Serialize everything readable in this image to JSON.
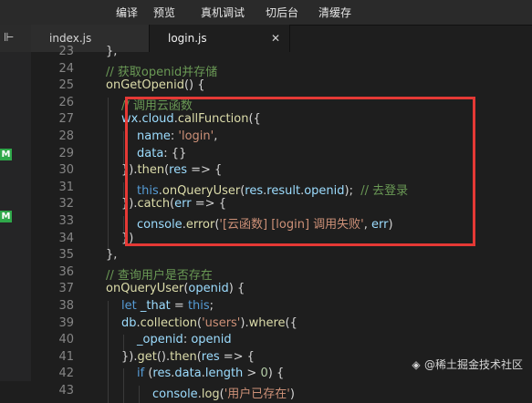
{
  "toolbar": {
    "items": [
      "编译",
      "预览",
      "真机调试",
      "切后台",
      "清缓存"
    ]
  },
  "tabs": [
    {
      "label": "index.js",
      "active": false
    },
    {
      "label": "login.js",
      "active": true
    }
  ],
  "sidebar": {
    "collapse_icon": "sidebar-collapse-icon",
    "badges": [
      "M",
      "M"
    ]
  },
  "line_numbers": [
    "23",
    "24",
    "25",
    "26",
    "27",
    "28",
    "29",
    "30",
    "31",
    "32",
    "33",
    "34",
    "35",
    "36",
    "37",
    "38",
    "39",
    "40",
    "41",
    "42",
    "43"
  ],
  "code": [
    {
      "indent": 1,
      "tokens": [
        {
          "t": "},",
          "c": ""
        }
      ]
    },
    {
      "indent": 1,
      "tokens": [
        {
          "t": "// 获取openid并存储",
          "c": "c"
        }
      ]
    },
    {
      "indent": 1,
      "tokens": [
        {
          "t": "onGetOpenid",
          "c": "f"
        },
        {
          "t": "() {",
          "c": ""
        }
      ]
    },
    {
      "indent": 2,
      "tokens": [
        {
          "t": "// 调用云函数",
          "c": "c"
        }
      ]
    },
    {
      "indent": 2,
      "tokens": [
        {
          "t": "wx",
          "c": "p"
        },
        {
          "t": ".",
          "c": ""
        },
        {
          "t": "cloud",
          "c": "p"
        },
        {
          "t": ".",
          "c": ""
        },
        {
          "t": "callFunction",
          "c": "f"
        },
        {
          "t": "({",
          "c": ""
        }
      ]
    },
    {
      "indent": 3,
      "tokens": [
        {
          "t": "name",
          "c": "p"
        },
        {
          "t": ": ",
          "c": ""
        },
        {
          "t": "'login'",
          "c": "s"
        },
        {
          "t": ",",
          "c": ""
        }
      ]
    },
    {
      "indent": 3,
      "tokens": [
        {
          "t": "data",
          "c": "p"
        },
        {
          "t": ": {}",
          "c": ""
        }
      ]
    },
    {
      "indent": 2,
      "tokens": [
        {
          "t": "}).",
          "c": ""
        },
        {
          "t": "then",
          "c": "f"
        },
        {
          "t": "(",
          "c": ""
        },
        {
          "t": "res",
          "c": "p"
        },
        {
          "t": " => {",
          "c": ""
        }
      ]
    },
    {
      "indent": 3,
      "tokens": [
        {
          "t": "this",
          "c": "k"
        },
        {
          "t": ".",
          "c": ""
        },
        {
          "t": "onQueryUser",
          "c": "f"
        },
        {
          "t": "(",
          "c": ""
        },
        {
          "t": "res",
          "c": "p"
        },
        {
          "t": ".",
          "c": ""
        },
        {
          "t": "result",
          "c": "p"
        },
        {
          "t": ".",
          "c": ""
        },
        {
          "t": "openid",
          "c": "p"
        },
        {
          "t": ");  ",
          "c": ""
        },
        {
          "t": "// 去登录",
          "c": "c"
        }
      ]
    },
    {
      "indent": 2,
      "tokens": [
        {
          "t": "}).",
          "c": ""
        },
        {
          "t": "catch",
          "c": "f"
        },
        {
          "t": "(",
          "c": ""
        },
        {
          "t": "err",
          "c": "p"
        },
        {
          "t": " => {",
          "c": ""
        }
      ]
    },
    {
      "indent": 3,
      "tokens": [
        {
          "t": "console",
          "c": "p"
        },
        {
          "t": ".",
          "c": ""
        },
        {
          "t": "error",
          "c": "f"
        },
        {
          "t": "(",
          "c": ""
        },
        {
          "t": "'[云函数] [login] 调用失败'",
          "c": "s"
        },
        {
          "t": ", ",
          "c": ""
        },
        {
          "t": "err",
          "c": "p"
        },
        {
          "t": ")",
          "c": ""
        }
      ]
    },
    {
      "indent": 2,
      "tokens": [
        {
          "t": "})",
          "c": ""
        }
      ]
    },
    {
      "indent": 1,
      "tokens": [
        {
          "t": "},",
          "c": ""
        }
      ]
    },
    {
      "indent": 1,
      "tokens": [
        {
          "t": "// 查询用户是否存在",
          "c": "c"
        }
      ]
    },
    {
      "indent": 1,
      "tokens": [
        {
          "t": "onQueryUser",
          "c": "f"
        },
        {
          "t": "(",
          "c": ""
        },
        {
          "t": "openid",
          "c": "p"
        },
        {
          "t": ") {",
          "c": ""
        }
      ]
    },
    {
      "indent": 2,
      "tokens": [
        {
          "t": "let",
          "c": "k"
        },
        {
          "t": " ",
          "c": ""
        },
        {
          "t": "_that",
          "c": "p"
        },
        {
          "t": " = ",
          "c": ""
        },
        {
          "t": "this",
          "c": "k"
        },
        {
          "t": ";",
          "c": ""
        }
      ]
    },
    {
      "indent": 2,
      "tokens": [
        {
          "t": "db",
          "c": "p"
        },
        {
          "t": ".",
          "c": ""
        },
        {
          "t": "collection",
          "c": "f"
        },
        {
          "t": "(",
          "c": ""
        },
        {
          "t": "'users'",
          "c": "s"
        },
        {
          "t": ").",
          "c": ""
        },
        {
          "t": "where",
          "c": "f"
        },
        {
          "t": "({",
          "c": ""
        }
      ]
    },
    {
      "indent": 3,
      "tokens": [
        {
          "t": "_openid",
          "c": "p"
        },
        {
          "t": ": ",
          "c": ""
        },
        {
          "t": "openid",
          "c": "p"
        }
      ]
    },
    {
      "indent": 2,
      "tokens": [
        {
          "t": "}).",
          "c": ""
        },
        {
          "t": "get",
          "c": "f"
        },
        {
          "t": "().",
          "c": ""
        },
        {
          "t": "then",
          "c": "f"
        },
        {
          "t": "(",
          "c": ""
        },
        {
          "t": "res",
          "c": "p"
        },
        {
          "t": " => {",
          "c": ""
        }
      ]
    },
    {
      "indent": 3,
      "tokens": [
        {
          "t": "if",
          "c": "k"
        },
        {
          "t": " (",
          "c": ""
        },
        {
          "t": "res",
          "c": "p"
        },
        {
          "t": ".",
          "c": ""
        },
        {
          "t": "data",
          "c": "p"
        },
        {
          "t": ".",
          "c": ""
        },
        {
          "t": "length",
          "c": "p"
        },
        {
          "t": " > ",
          "c": ""
        },
        {
          "t": "0",
          "c": "n"
        },
        {
          "t": ") {",
          "c": ""
        }
      ]
    },
    {
      "indent": 4,
      "tokens": [
        {
          "t": "console",
          "c": "p"
        },
        {
          "t": ".",
          "c": ""
        },
        {
          "t": "log",
          "c": "f"
        },
        {
          "t": "(",
          "c": ""
        },
        {
          "t": "'用户已存在'",
          "c": "s"
        },
        {
          "t": ")",
          "c": ""
        }
      ]
    }
  ],
  "watermark": {
    "icon": "juejin-icon",
    "text": "@稀土掘金技术社区"
  },
  "colors": {
    "highlight_border": "#e53935",
    "badge_green": "#2fa84a"
  }
}
